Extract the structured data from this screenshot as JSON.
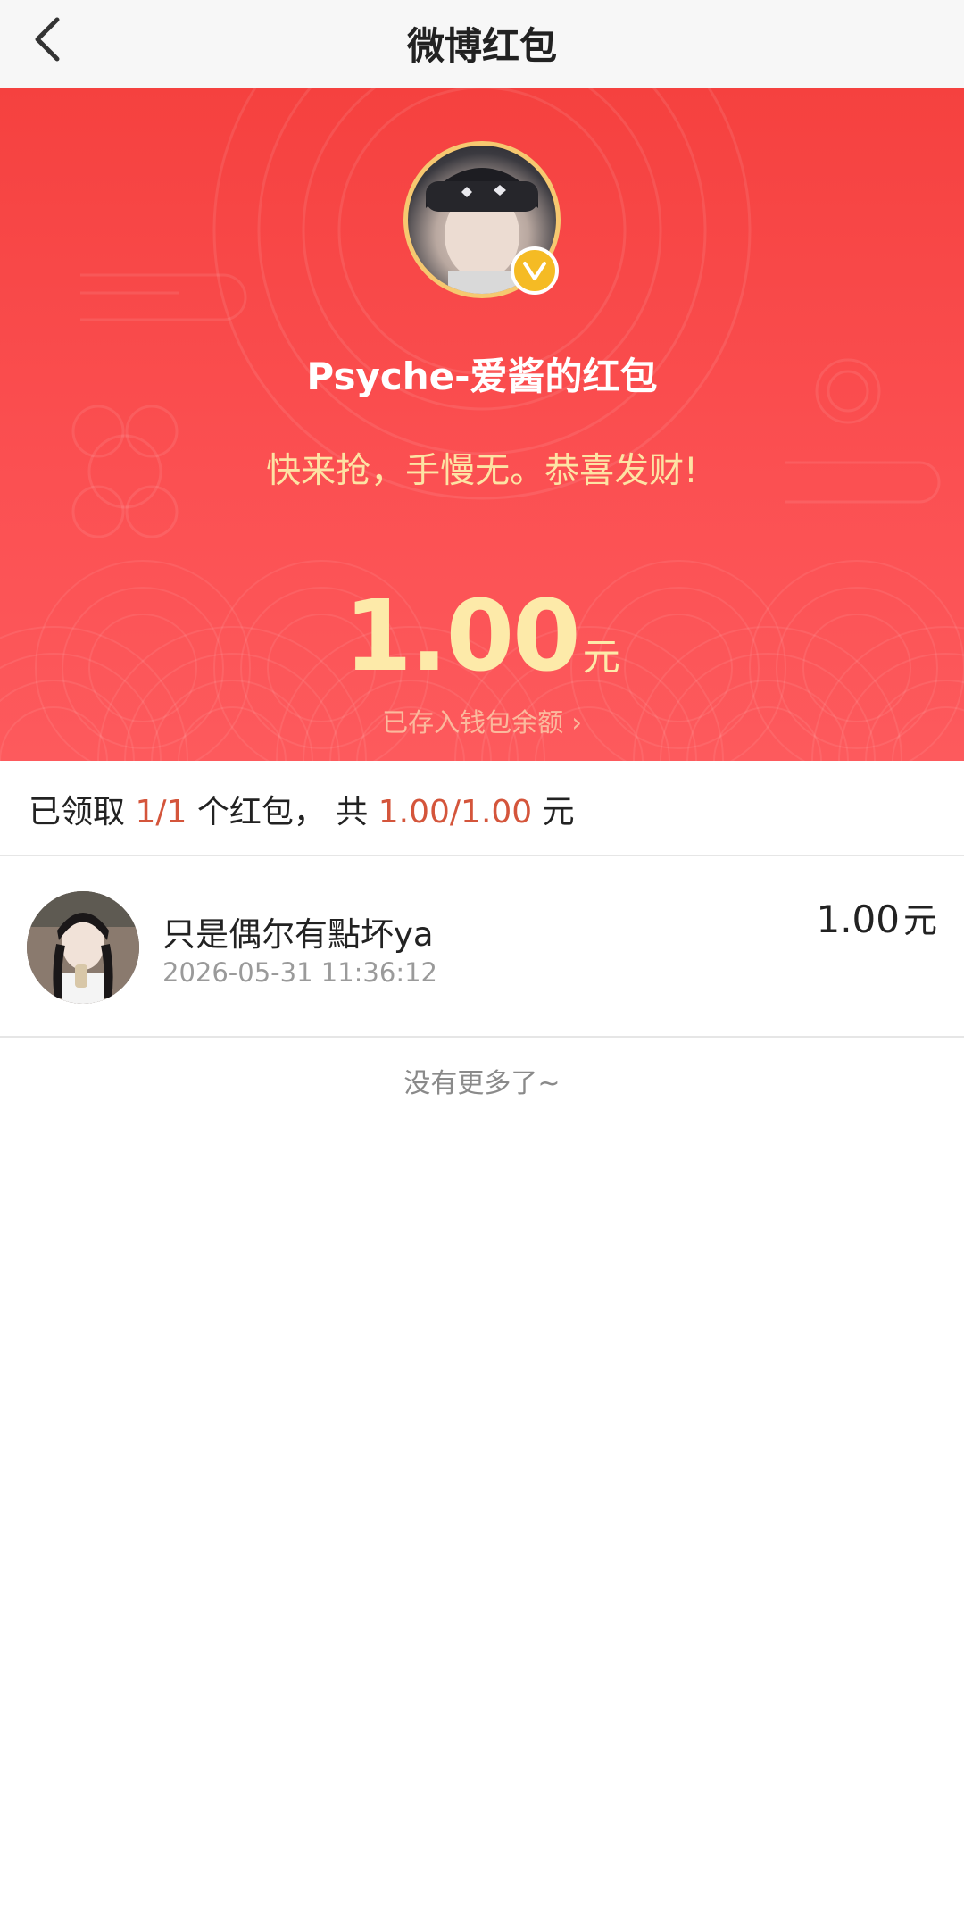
{
  "nav": {
    "title": "微博红包"
  },
  "hero": {
    "sender_name": "Psyche-爱酱的红包",
    "greeting": "快来抢，手慢无。恭喜发财!",
    "amount": "1.00",
    "amount_unit": "元",
    "wallet_link": "已存入钱包余额",
    "chevron": "›",
    "badge_letter": "V"
  },
  "summary": {
    "prefix": "已领取",
    "count": "1/1",
    "middle": "个红包， 共",
    "total": "1.00/1.00",
    "suffix": "元"
  },
  "records": [
    {
      "name": "只是偶尔有點坏ya",
      "time": "2026-05-31 11:36:12",
      "amount": "1.00",
      "unit": "元"
    }
  ],
  "footer": {
    "no_more": "没有更多了~"
  },
  "colors": {
    "hero_red": "#f5413f",
    "gold": "#fde3a4",
    "highlight": "#d4553b"
  },
  "icons": [
    "back-arrow-icon",
    "verified-icon",
    "chevron-right-icon"
  ]
}
